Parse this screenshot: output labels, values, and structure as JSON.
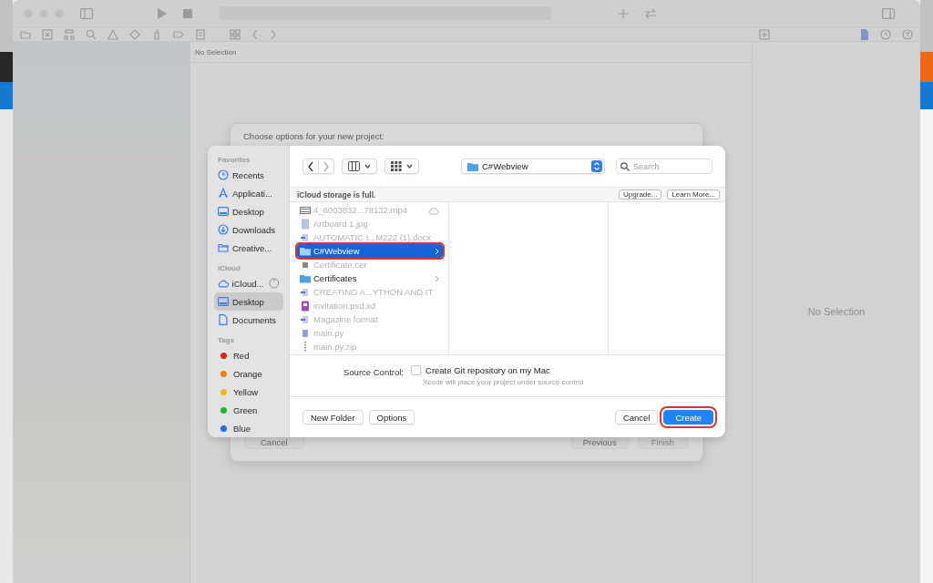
{
  "editor": {
    "header": "No Selection"
  },
  "inspector": {
    "placeholder": "No Selection"
  },
  "project_sheet": {
    "title": "Choose options for your new project:",
    "buttons": [
      {
        "label": "Cancel",
        "disabled": false
      },
      {
        "label": "Previous",
        "disabled": false
      },
      {
        "label": "Finish",
        "disabled": true
      }
    ]
  },
  "save_dialog": {
    "sidebar": [
      {
        "title": "Favorites",
        "items": [
          {
            "label": "Recents",
            "kind": "clock",
            "selected": false
          },
          {
            "label": "Applicati...",
            "kind": "apps",
            "selected": false
          },
          {
            "label": "Desktop",
            "kind": "desktop",
            "selected": false
          },
          {
            "label": "Downloads",
            "kind": "download",
            "selected": false
          },
          {
            "label": "Creative...",
            "kind": "folder",
            "selected": false
          }
        ]
      },
      {
        "title": "iCloud",
        "items": [
          {
            "label": "iCloud...",
            "kind": "cloud",
            "selected": false,
            "syncing": true
          },
          {
            "label": "Desktop",
            "kind": "desktop",
            "selected": true
          },
          {
            "label": "Documents",
            "kind": "document",
            "selected": false
          }
        ]
      },
      {
        "title": "Tags",
        "items": [
          {
            "label": "Red",
            "kind": "tag",
            "color": "#e8201c",
            "selected": false
          },
          {
            "label": "Orange",
            "kind": "tag",
            "color": "#f0800e",
            "selected": false
          },
          {
            "label": "Yellow",
            "kind": "tag",
            "color": "#f2b71a",
            "selected": false
          },
          {
            "label": "Green",
            "kind": "tag",
            "color": "#1fb42a",
            "selected": false
          },
          {
            "label": "Blue",
            "kind": "tag",
            "color": "#1a6ef0",
            "selected": false
          }
        ]
      }
    ],
    "location": "C#Webview",
    "search": {
      "placeholder": "Search"
    },
    "notice": {
      "text": "iCloud storage is full.",
      "buttons": [
        "Upgrade...",
        "Learn More..."
      ]
    },
    "files": [
      {
        "name": "4_6003832...78132.mp4",
        "kind": "video",
        "dimmed": true,
        "selected": false,
        "in_cloud": true
      },
      {
        "name": "Artboard 1.jpg",
        "kind": "image",
        "dimmed": true,
        "selected": false
      },
      {
        "name": "AUTOMATIC I...M222 (1).docx",
        "kind": "doc",
        "dimmed": true,
        "selected": false
      },
      {
        "name": "C#Webview",
        "kind": "folder",
        "dimmed": false,
        "selected": true,
        "chevron": true,
        "highlighted": true
      },
      {
        "name": "Certificate.cer",
        "kind": "cert",
        "dimmed": true,
        "selected": false
      },
      {
        "name": "Certificates",
        "kind": "folder",
        "dimmed": false,
        "selected": false,
        "chevron": true
      },
      {
        "name": "CREATING A...YTHON AND IT",
        "kind": "doc",
        "dimmed": true,
        "selected": false
      },
      {
        "name": "invitation.psd.xd",
        "kind": "psd",
        "dimmed": true,
        "selected": false
      },
      {
        "name": "Magazine format",
        "kind": "doc",
        "dimmed": true,
        "selected": false
      },
      {
        "name": "main.py",
        "kind": "script",
        "dimmed": true,
        "selected": false
      },
      {
        "name": "main.py.zip",
        "kind": "zip",
        "dimmed": true,
        "selected": false
      }
    ],
    "source_control": {
      "label": "Source Control:",
      "checkbox": {
        "label": "Create Git repository on my Mac",
        "checked": false
      },
      "hint": "Xcode will place your project under source control"
    },
    "buttons_left": [
      {
        "label": "New Folder",
        "default": false
      },
      {
        "label": "Options",
        "default": false
      }
    ],
    "buttons_right": [
      {
        "label": "Cancel",
        "default": false
      },
      {
        "label": "Create",
        "default": true,
        "highlighted": true
      }
    ]
  }
}
